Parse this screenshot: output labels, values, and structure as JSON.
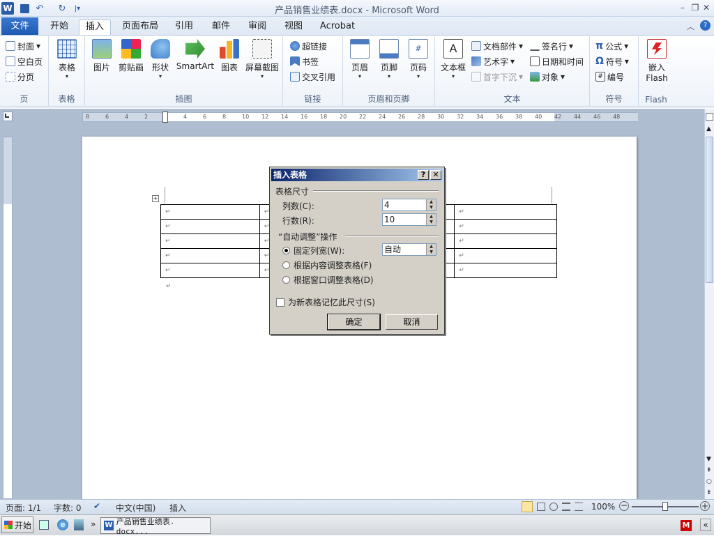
{
  "window": {
    "title": "产品销售业绩表.docx - Microsoft Word"
  },
  "quick_access": {
    "undo_glyph": "↶",
    "redo_glyph": "↻",
    "customize_glyph": "|▾"
  },
  "window_controls": {
    "minimize": "–",
    "restore": "❐",
    "close": "✕"
  },
  "tabs": {
    "file": "文件",
    "items": [
      "开始",
      "插入",
      "页面布局",
      "引用",
      "邮件",
      "审阅",
      "视图",
      "Acrobat"
    ],
    "active": "插入"
  },
  "ribbon": {
    "groups": {
      "pages": {
        "label": "页",
        "items": [
          "封面",
          "空白页",
          "分页"
        ]
      },
      "tables": {
        "label": "表格",
        "items": [
          "表格"
        ]
      },
      "illustrations": {
        "label": "插图",
        "items": [
          "图片",
          "剪贴画",
          "形状",
          "SmartArt",
          "图表",
          "屏幕截图"
        ]
      },
      "links": {
        "label": "链接",
        "items": [
          "超链接",
          "书签",
          "交叉引用"
        ]
      },
      "header_footer": {
        "label": "页眉和页脚",
        "items": [
          "页眉",
          "页脚",
          "页码"
        ]
      },
      "text": {
        "label": "文本",
        "items": [
          "文本框",
          "文档部件",
          "艺术字",
          "首字下沉",
          "签名行",
          "日期和时间",
          "对象"
        ]
      },
      "symbols": {
        "label": "符号",
        "items": [
          "公式",
          "符号",
          "编号"
        ]
      },
      "flash": {
        "label": "Flash",
        "items": [
          "嵌入",
          "Flash"
        ]
      }
    }
  },
  "ruler": {
    "h_ticks": [
      "8",
      "6",
      "4",
      "2",
      "2",
      "4",
      "6",
      "8",
      "10",
      "12",
      "14",
      "16",
      "18",
      "20",
      "22",
      "24",
      "26",
      "28",
      "30",
      "32",
      "34",
      "36",
      "38",
      "40",
      "42",
      "44",
      "46",
      "48"
    ]
  },
  "document": {
    "paragraph_mark": "↵",
    "table_rows": 5
  },
  "dialog": {
    "title": "插入表格",
    "help": "?",
    "close": "✕",
    "section_size": "表格尺寸",
    "columns_label": "列数(C):",
    "columns_value": "4",
    "rows_label": "行数(R):",
    "rows_value": "10",
    "section_autofit": "“自动调整”操作",
    "fixed_width_label": "固定列宽(W):",
    "fixed_width_value": "自动",
    "autofit_content": "根据内容调整表格(F)",
    "autofit_window": "根据窗口调整表格(D)",
    "remember_label": "为新表格记忆此尺寸(S)",
    "ok": "确定",
    "cancel": "取消"
  },
  "status": {
    "page": "页面: 1/1",
    "words": "字数: 0",
    "language": "中文(中国)",
    "mode": "插入",
    "zoom": "100%"
  },
  "taskbar": {
    "start": "开始",
    "task": "产品销售业绩表. docx...",
    "more": "»"
  },
  "colors": {
    "file_tab": "#1f5bb0",
    "dialog_title": "#0a246a",
    "doc_bg": "#aebdd0"
  }
}
